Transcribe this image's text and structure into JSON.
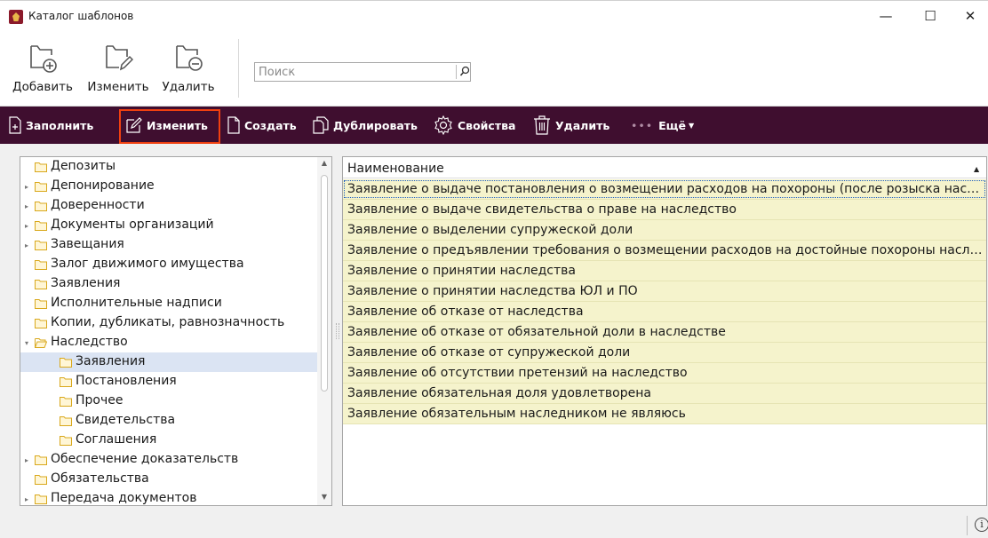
{
  "window": {
    "title": "Каталог шаблонов",
    "minimize_glyph": "—",
    "maximize_glyph": "☐",
    "close_glyph": "✕"
  },
  "ribbon": {
    "add_label": "Добавить",
    "edit_label": "Изменить",
    "delete_label": "Удалить",
    "search_placeholder": "Поиск"
  },
  "toolbar": {
    "fill_label": "Заполнить",
    "edit_label": "Изменить",
    "create_label": "Создать",
    "duplicate_label": "Дублировать",
    "properties_label": "Свойства",
    "delete_label": "Удалить",
    "more_label": "Ещё",
    "more_dots": "•••",
    "accent_color": "#3f0e2f",
    "highlight_color": "#f04010"
  },
  "tree": {
    "items": [
      {
        "label": "Депозиты",
        "level": 0,
        "expandable": false,
        "expanded": false,
        "selected": false
      },
      {
        "label": "Депонирование",
        "level": 0,
        "expandable": true,
        "expanded": false,
        "selected": false
      },
      {
        "label": "Доверенности",
        "level": 0,
        "expandable": true,
        "expanded": false,
        "selected": false
      },
      {
        "label": "Документы организаций",
        "level": 0,
        "expandable": true,
        "expanded": false,
        "selected": false
      },
      {
        "label": "Завещания",
        "level": 0,
        "expandable": true,
        "expanded": false,
        "selected": false
      },
      {
        "label": "Залог движимого имущества",
        "level": 0,
        "expandable": false,
        "expanded": false,
        "selected": false
      },
      {
        "label": "Заявления",
        "level": 0,
        "expandable": false,
        "expanded": false,
        "selected": false
      },
      {
        "label": "Исполнительные надписи",
        "level": 0,
        "expandable": false,
        "expanded": false,
        "selected": false
      },
      {
        "label": "Копии, дубликаты, равнозначность",
        "level": 0,
        "expandable": false,
        "expanded": false,
        "selected": false
      },
      {
        "label": "Наследство",
        "level": 0,
        "expandable": true,
        "expanded": true,
        "selected": false
      },
      {
        "label": "Заявления",
        "level": 1,
        "expandable": false,
        "expanded": false,
        "selected": true
      },
      {
        "label": "Постановления",
        "level": 1,
        "expandable": false,
        "expanded": false,
        "selected": false
      },
      {
        "label": "Прочее",
        "level": 1,
        "expandable": false,
        "expanded": false,
        "selected": false
      },
      {
        "label": "Свидетельства",
        "level": 1,
        "expandable": false,
        "expanded": false,
        "selected": false
      },
      {
        "label": "Соглашения",
        "level": 1,
        "expandable": false,
        "expanded": false,
        "selected": false
      },
      {
        "label": "Обеспечение доказательств",
        "level": 0,
        "expandable": true,
        "expanded": false,
        "selected": false
      },
      {
        "label": "Обязательства",
        "level": 0,
        "expandable": false,
        "expanded": false,
        "selected": false
      },
      {
        "label": "Передача документов",
        "level": 0,
        "expandable": true,
        "expanded": false,
        "selected": false
      }
    ]
  },
  "grid": {
    "column_header": "Наименование",
    "rows": [
      "Заявление о выдаче постановления о возмещении расходов на похороны (после розыска наследников)",
      "Заявление о выдаче свидетельства о праве на наследство",
      "Заявление о выделении супружеской доли",
      "Заявление о предъявлении требования о возмещении расходов на достойные похороны наследодателя",
      "Заявление о принятии наследства",
      "Заявление о принятии наследства ЮЛ и ПО",
      "Заявление об отказе от наследства",
      "Заявление об отказе от обязательной доли в наследстве",
      "Заявление об отказе от супружеской доли",
      "Заявление об отсутствии претензий на наследство",
      "Заявление обязательная доля удовлетворена",
      "Заявление обязательным наследником не являюсь"
    ],
    "row_color": "#f5f3cc"
  },
  "statusbar": {
    "info_glyph": "i"
  }
}
